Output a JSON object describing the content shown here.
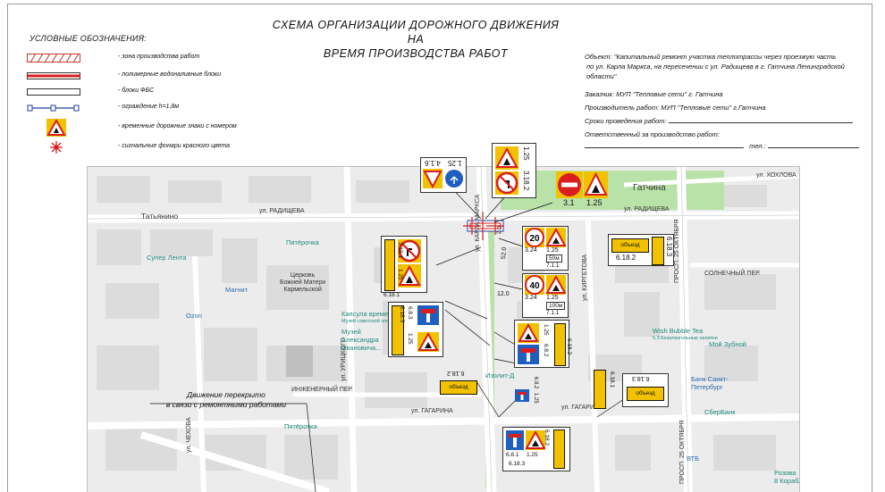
{
  "title": {
    "line1": "СХЕМА ОРГАНИЗАЦИИ ДОРОЖНОГО ДВИЖЕНИЯ НА",
    "line2": "ВРЕМЯ ПРОИЗВОДСТВА РАБОТ"
  },
  "legend": {
    "heading": "УСЛОВНЫЕ ОБОЗНАЧЕНИЯ:",
    "items": [
      {
        "icon": "hatched-zone-icon",
        "label": "- зона производства работ"
      },
      {
        "icon": "water-block-icon",
        "label": "- полимерные водоналивные блоки"
      },
      {
        "icon": "fbs-block-icon",
        "label": "- блоки ФБС"
      },
      {
        "icon": "fence-icon",
        "label": "- ограждение h=1,8м"
      },
      {
        "icon": "temporary-sign-icon",
        "label": "- временные дорожные знаки с номером"
      },
      {
        "icon": "red-lantern-icon",
        "label": "- сигнальные фонари красного цвета"
      }
    ]
  },
  "info": {
    "object_1": "Объект: \"Капитальный ремонт участка теплотрассы через проезжую часть",
    "object_2": "по ул. Карла Маркса, на пересечении с ул. Радищева в г. Гатчина Ленинградской",
    "object_3": "области\"",
    "customer": "Заказчик:  МУП \"Тепловые сети\" г. Гатчина",
    "contractor": "Производитель работ: МУП \"Тепловые сети\" г.Гатчина",
    "terms": "Сроки проведения работ:",
    "responsible": "Ответственный за производство работ:",
    "phone": "тел.:"
  },
  "map": {
    "streets": {
      "radishcheva_w": "ул. РАДИЩЕВА",
      "radishcheva_e": "ул. РАДИЩЕВА",
      "gagarina_w": "ул. ГАГАРИНА",
      "gagarina_e": "ул. ГАГАРИНА",
      "khokhlova": "ул. ХОХЛОВА",
      "solnechny": "СОЛНЕЧНЫЙ ПЕР.",
      "inzhenerny": "ИНЖЕНЕРНЫЙ ПЕР.",
      "kirgetova": "ул. КИРГЕТОВА",
      "chekhova": "ул. ЧЕХОВА",
      "uritskogo": "ул. УРИЦКОГО",
      "karla_marksa": "ул. КАРЛА МАРКСА",
      "prospekt_25": "ПРОСП. 25 ОКТЯБРЯ"
    },
    "poi": {
      "tatyanino": "Татьянино",
      "pyaterochka_1": "Пятёрочка",
      "super_lenta": "Супер Лента",
      "magnit": "Магнит",
      "church_1": "Церковь",
      "church_2": "Божией Матери",
      "church_3": "Кармельской",
      "ozon": "Ozon",
      "capsule_1": "Капсула времени",
      "capsule_2": "Музей советской эпохи",
      "museum_1": "Музей",
      "museum_2": "Александра",
      "museum_3": "Ивановича...",
      "izolit": "Изолит-Д",
      "gatchina": "Гатчина",
      "wish_1": "Wish Bubble Tea",
      "wish_2": "5.3 Безалкогольные напитки",
      "moy_zubnoy": "Мой Зубной",
      "bank_1": "Банк Санкт-",
      "bank_2": "Петербург",
      "sberbank": "СберБанк",
      "pyaterochka_2": "Пятёрочка",
      "vtb": "ВТБ",
      "rozova_1": "Розова",
      "rozova_2": "8 Корабл"
    },
    "closure_1": "Движение перекрыто",
    "closure_2": "в связи с ремонтными работами",
    "detour_text": "объезд",
    "signs": {
      "s_1_25": "1.25",
      "s_3_18_2": "3.18.2",
      "s_4_1_6": "4.1.6",
      "s_3_1": "3.1",
      "s_1_25b": "1.25",
      "s_20": "20",
      "s_3_24a": "3.24",
      "s_1_25c": "1.25",
      "s_50m": "50м",
      "s_7_1_1a": "7.1.1",
      "s_40": "40",
      "s_3_24b": "3.24",
      "s_1_25d": "1.25",
      "s_100m": "100м",
      "s_7_1_1b": "7.1.1",
      "s_6_18_2a": "6.18.2",
      "s_6_18_3a": "6.18.3",
      "s_3_18_1": "3.18.1",
      "s_1_25e": "1.25",
      "s_6_18_1a": "6.18.1",
      "s_6_8_3": "6.8.3",
      "s_1_25f": "1.25",
      "s_6_18_3b": "6.18.3",
      "s_1_25g": "1.25",
      "s_6_8_2a": "6.8.2",
      "s_6_18_2b": "6.18.2",
      "s_6_18_2c": "6.18.2",
      "s_6_8_2b": "6.8.2",
      "s_1_25h": "1.25",
      "s_6_18_1b": "6.18.1",
      "s_6_18_3c": "6.18.3",
      "s_6_8_1": "6.8.1",
      "s_1_25i": "1.25",
      "s_6_18_3d": "6.18.3",
      "s_6_18_2d": "6.18.2",
      "s_52_0": "52.0",
      "s_12_0": "12.0",
      "s_2_0": "2.0"
    }
  },
  "colors": {
    "sign_yellow": "#f2c200",
    "sign_red": "#d81e1e",
    "sign_blue": "#1f5fbf",
    "map_road": "#ffffff",
    "map_block": "#dcdcdc",
    "park": "#b9e2a8"
  }
}
